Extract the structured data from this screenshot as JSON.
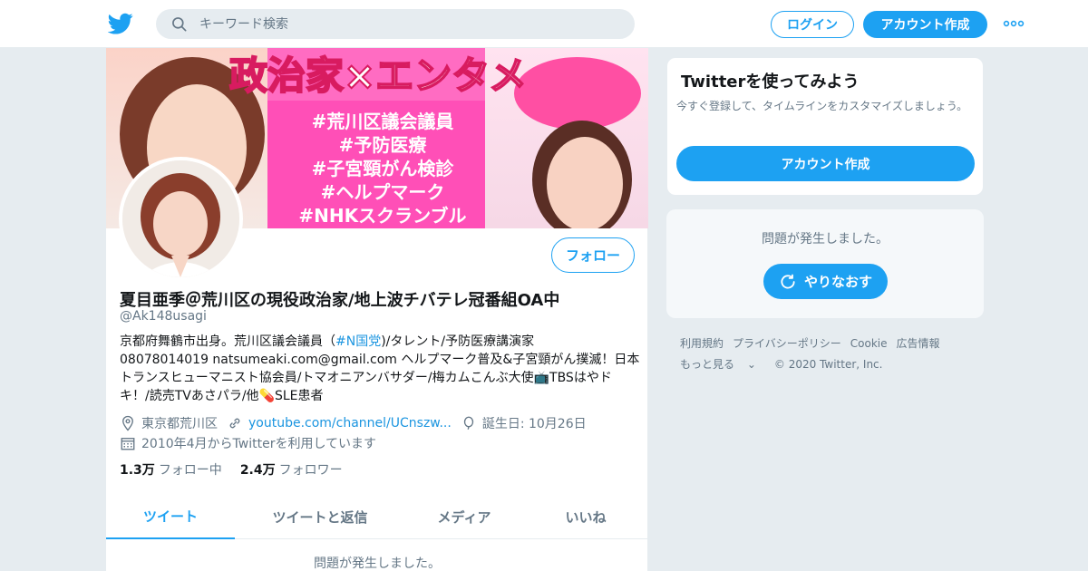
{
  "header": {
    "search_placeholder": "キーワード検索",
    "login_label": "ログイン",
    "signup_label": "アカウント作成"
  },
  "banner": {
    "title_text": "政治家×エンタメ",
    "tags": [
      "#荒川区議会議員",
      "#予防医療",
      "#子宮頸がん検診",
      "#ヘルプマーク",
      "#NHKスクランブル"
    ]
  },
  "profile": {
    "follow_label": "フォロー",
    "name": "夏目亜季＠荒川区の現役政治家/地上波チバテレ冠番組OA中",
    "handle": "@Ak148usagi",
    "bio_line1_a": "京都府舞鶴市出身。荒川区議会議員（",
    "bio_hashtag": "#N国党",
    "bio_line1_b": ")/タレント/予防医療講演家",
    "bio_line2": "08078014019 natsumeaki.com@gmail.com ヘルプマーク普及&子宮頸がん撲滅！日本トランスヒューマニスト協会員/トマオニアンバサダー/梅カムこんぶ大使📺TBSはやドキ！/読売TVあさパラ/他💊SLE患者",
    "location": "東京都荒川区",
    "url": "youtube.com/channel/UCnszw...",
    "birthday": "誕生日: 10月26日",
    "joined": "2010年4月からTwitterを利用しています",
    "following_count": "1.3万",
    "following_label": "フォロー中",
    "followers_count": "2.4万",
    "followers_label": "フォロワー"
  },
  "tabs": [
    {
      "label": "ツイート",
      "active": true
    },
    {
      "label": "ツイートと返信",
      "active": false
    },
    {
      "label": "メディア",
      "active": false
    },
    {
      "label": "いいね",
      "active": false
    }
  ],
  "timeline": {
    "error_text": "問題が発生しました。"
  },
  "sidebar": {
    "signup_title": "Twitterを使ってみよう",
    "signup_desc": "今すぐ登録して、タイムラインをカスタマイズしましょう。",
    "signup_button": "アカウント作成",
    "error_text": "問題が発生しました。",
    "retry_button": "やりなおす"
  },
  "footer": {
    "links": [
      "利用規約",
      "プライバシーポリシー",
      "Cookie",
      "広告情報",
      "もっと見る"
    ],
    "copyright": "© 2020 Twitter, Inc."
  },
  "colors": {
    "accent": "#1da1f2",
    "link": "#1b95e0",
    "muted": "#657786",
    "bg": "#e6ecf0"
  }
}
